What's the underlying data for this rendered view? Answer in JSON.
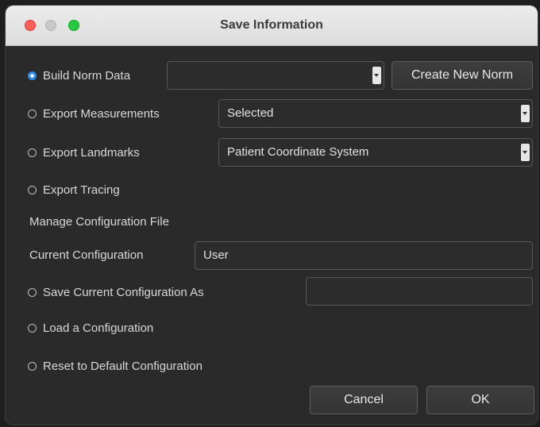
{
  "window": {
    "title": "Save Information"
  },
  "options": {
    "build_norm_data": {
      "label": "Build Norm Data",
      "selected": true,
      "combo_value": ""
    },
    "create_new_norm_label": "Create New Norm",
    "export_measurements": {
      "label": "Export Measurements",
      "selected": false,
      "combo_value": "Selected"
    },
    "export_landmarks": {
      "label": "Export Landmarks",
      "selected": false,
      "combo_value": "Patient Coordinate System"
    },
    "export_tracing": {
      "label": "Export Tracing",
      "selected": false
    }
  },
  "config": {
    "section_title": "Manage Configuration File",
    "current_label": "Current Configuration",
    "current_value": "User",
    "save_as": {
      "label": "Save Current Configuration As",
      "selected": false,
      "value": ""
    },
    "load": {
      "label": "Load a Configuration",
      "selected": false
    },
    "reset": {
      "label": "Reset to Default Configuration",
      "selected": false
    }
  },
  "buttons": {
    "cancel_label": "Cancel",
    "ok_label": "OK"
  },
  "colors": {
    "accent": "#2f8bf0",
    "background": "#2a2a2a",
    "titlebar": "#e4e4e4",
    "close": "#ff5f57",
    "minimize": "#c9c9c9",
    "maximize": "#28c840"
  }
}
